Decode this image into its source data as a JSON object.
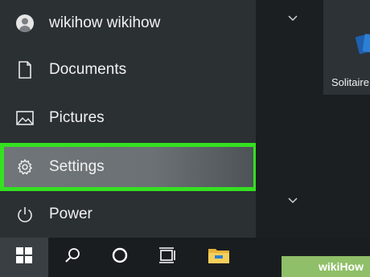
{
  "start_menu": {
    "user_name": "wikihow wikihow",
    "items": [
      {
        "label": "Documents",
        "icon": "document-icon"
      },
      {
        "label": "Pictures",
        "icon": "picture-icon"
      },
      {
        "label": "Settings",
        "icon": "gear-icon",
        "highlighted": true
      },
      {
        "label": "Power",
        "icon": "power-icon"
      }
    ]
  },
  "tiles": {
    "solitaire_label": "Solitaire"
  },
  "taskbar": {
    "icons": [
      "windows-start-icon",
      "search-icon",
      "cortana-icon",
      "task-view-icon",
      "file-explorer-icon"
    ]
  },
  "watermark": {
    "prefix": "wiki",
    "suffix": "How"
  },
  "colors": {
    "highlight_border": "#35e021",
    "panel_bg": "#2b3033"
  }
}
